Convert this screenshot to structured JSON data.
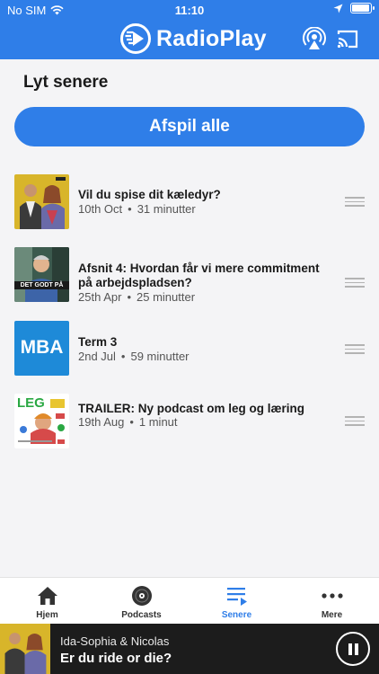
{
  "status": {
    "carrier": "No SIM",
    "time": "11:10"
  },
  "header": {
    "brand": "RadioPlay",
    "airplay_icon": "airplay-icon",
    "cast_icon": "cast-icon"
  },
  "section": {
    "title": "Lyt senere"
  },
  "play_all_label": "Afspil alle",
  "episodes": [
    {
      "title_line1": "Vil du spise dit kæledyr?",
      "title_line2": "",
      "date": "10th Oct",
      "duration": "31 minutter"
    },
    {
      "title_line1": "Afsnit 4: Hvordan får vi mere commitment",
      "title_line2": "på arbejdspladsen?",
      "date": "25th Apr",
      "duration": "25 minutter"
    },
    {
      "title_line1": "Term 3",
      "title_line2": "",
      "date": "2nd Jul",
      "duration": "59 minutter"
    },
    {
      "title_line1": "TRAILER: Ny podcast om leg og læring",
      "title_line2": "",
      "date": "19th Aug",
      "duration": "1 minut"
    }
  ],
  "thumb_text": {
    "t2": "DET GODT PÅ",
    "t3": "MBA",
    "t4": "LEG"
  },
  "meta_separator": "•",
  "tabs": [
    {
      "label": "Hjem",
      "icon": "home-icon"
    },
    {
      "label": "Podcasts",
      "icon": "podcast-disc-icon"
    },
    {
      "label": "Senere",
      "icon": "playlist-icon"
    },
    {
      "label": "Mere",
      "icon": "more-dots-icon"
    }
  ],
  "player": {
    "subtitle": "Ida-Sophia & Nicolas",
    "title": "Er du ride or die?"
  },
  "colors": {
    "accent": "#2f7ee8",
    "player_bg": "#1c1c1c"
  }
}
